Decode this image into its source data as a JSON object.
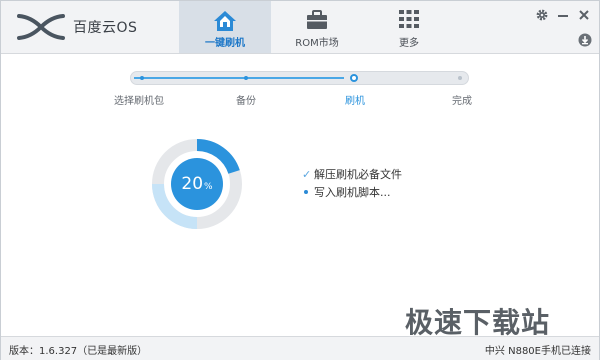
{
  "brand": {
    "name": "百度云OS",
    "logo_icon": "baidu-cloud-os-logo"
  },
  "nav": {
    "tabs": [
      {
        "label": "一键刷机",
        "icon": "home-icon",
        "active": true
      },
      {
        "label": "ROM市场",
        "icon": "briefcase-icon",
        "active": false
      },
      {
        "label": "更多",
        "icon": "grid-icon",
        "active": false
      }
    ]
  },
  "window_controls": {
    "settings": "gear-icon",
    "minimize": "minimize-icon",
    "close": "close-icon",
    "download": "download-icon"
  },
  "steps": [
    {
      "label": "选择刷机包",
      "state": "done"
    },
    {
      "label": "备份",
      "state": "done"
    },
    {
      "label": "刷机",
      "state": "current"
    },
    {
      "label": "完成",
      "state": "todo"
    }
  ],
  "progress": {
    "percent": 20,
    "value_text": "20",
    "unit": "%"
  },
  "tasks": [
    {
      "text": "解压刷机必备文件",
      "state": "done"
    },
    {
      "text": "写入刷机脚本...",
      "state": "in-progress"
    }
  ],
  "statusbar": {
    "version": "版本：1.6.327（已是最新版）",
    "device": "中兴 N880E手机已连接"
  },
  "watermark": "极速下载站",
  "colors": {
    "accent": "#2b93dd",
    "ring_track": "#e5e7ea",
    "ring_light": "#c6e3f7"
  }
}
